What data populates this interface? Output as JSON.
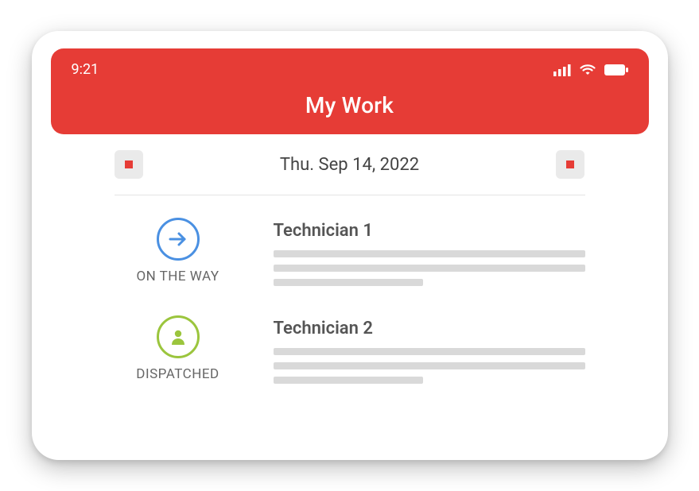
{
  "statusbar": {
    "time": "9:21"
  },
  "header": {
    "title": "My Work"
  },
  "date_nav": {
    "date_label": "Thu.  Sep 14, 2022"
  },
  "jobs": [
    {
      "status_label": "ON THE WAY",
      "tech_name": "Technician 1"
    },
    {
      "status_label": "DISPATCHED",
      "tech_name": "Technician 2"
    }
  ],
  "colors": {
    "accent": "#E63C36",
    "status_onway": "#4A90E2",
    "status_dispatched": "#9BC53D"
  }
}
